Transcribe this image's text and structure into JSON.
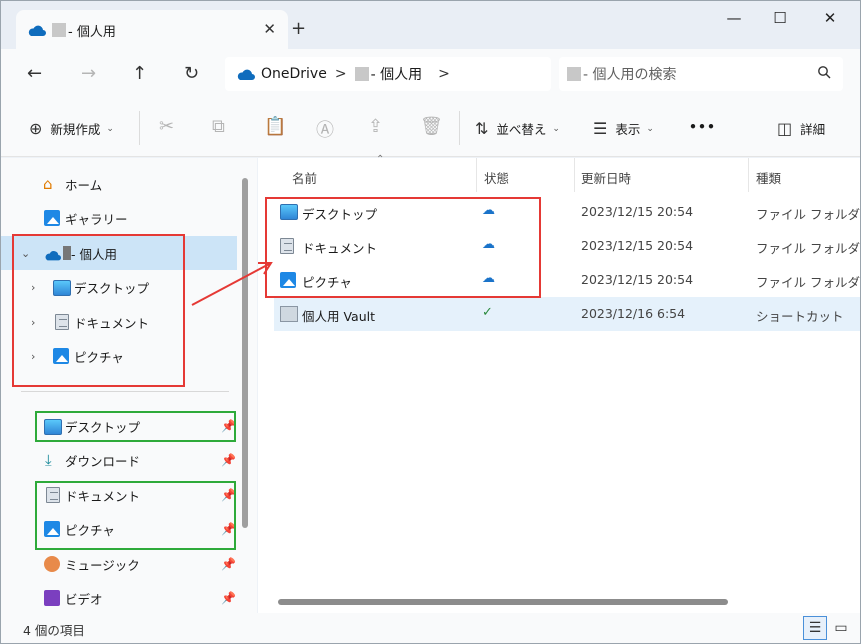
{
  "tab": {
    "title": " - 個人用",
    "close": "✕",
    "new_tab": "+"
  },
  "window_controls": {
    "minimize": "—",
    "maximize": "☐",
    "close": "✕"
  },
  "nav": {
    "back": "←",
    "forward": "→",
    "up": "↑",
    "refresh": "↻"
  },
  "address": {
    "root": "OneDrive",
    "sep1": ">",
    "folder": " - 個人用",
    "sep2": ">"
  },
  "search": {
    "placeholder": " - 個人用の検索",
    "icon": "search-icon"
  },
  "commands": {
    "new": "新規作成",
    "sort": "並べ替え",
    "view": "表示",
    "more": "•••",
    "details": "詳細"
  },
  "sidebar": {
    "home": "ホーム",
    "gallery": "ギャラリー",
    "onedrive": "- 個人用",
    "sub": [
      "デスクトップ",
      "ドキュメント",
      "ピクチャ"
    ],
    "quick": [
      "デスクトップ",
      "ダウンロード",
      "ドキュメント",
      "ピクチャ",
      "ミュージック",
      "ビデオ"
    ]
  },
  "columns": {
    "name": "名前",
    "status": "状態",
    "modified": "更新日時",
    "type": "種類"
  },
  "rows": [
    {
      "name": "デスクトップ",
      "status": "☁",
      "date": "2023/12/15 20:54",
      "type": "ファイル フォルダー",
      "icon": "desktop-folder-icon"
    },
    {
      "name": "ドキュメント",
      "status": "☁",
      "date": "2023/12/15 20:54",
      "type": "ファイル フォルダー",
      "icon": "documents-folder-icon"
    },
    {
      "name": "ピクチャ",
      "status": "☁",
      "date": "2023/12/15 20:54",
      "type": "ファイル フォルダー",
      "icon": "pictures-folder-icon"
    },
    {
      "name": "個人用 Vault",
      "status": "✓",
      "date": "2023/12/16 6:54",
      "type": "ショートカット",
      "icon": "vault-shortcut-icon"
    }
  ],
  "status_bar": {
    "count": "4 個の項目"
  },
  "colors": {
    "accent": "#0f6cbd",
    "selection": "#cce4f7",
    "annotation_red": "#e53935",
    "annotation_green": "#2eaa3a"
  }
}
